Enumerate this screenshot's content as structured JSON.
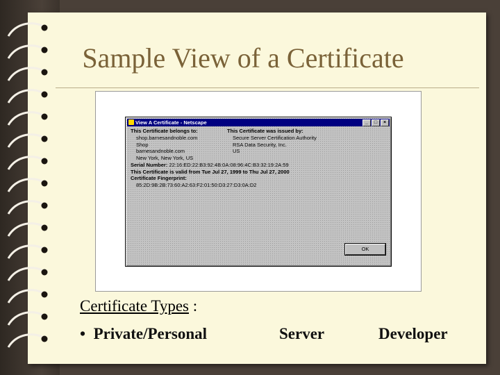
{
  "slide": {
    "title": "Sample View of a Certificate",
    "types_label": "Certificate Types",
    "types_suffix": " :",
    "bullet": "•",
    "items": [
      "Private/Personal",
      "Server",
      "Developer"
    ]
  },
  "window": {
    "title": "View A Certificate - Netscape",
    "belongs_heading": "This Certificate belongs to:",
    "belongs_lines": [
      "shop.barnesandnoble.com",
      "Shop",
      "barnesandnoble.com",
      "New York, New York, US"
    ],
    "issued_heading": "This Certificate was issued by:",
    "issued_lines": [
      "Secure Server Certification Authority",
      "RSA Data Security, Inc.",
      "US"
    ],
    "serial_label": "Serial Number:",
    "serial_value": "22:16:ED:22:B3:92:4B:0A:08:96:4C:B3:32:19:2A:59",
    "validity": "This Certificate is valid from Tue Jul 27, 1999 to Thu Jul 27, 2000",
    "fingerprint_label": "Certificate Fingerprint:",
    "fingerprint_value": "85:2D:9B:2B:73:60:A2:63:F2:01:50:D3:27:D3:0A:D2",
    "ok_label": "OK",
    "ctrl_minimize": "_",
    "ctrl_maximize": "□",
    "ctrl_close": "×"
  },
  "colors": {
    "page": "#fbf8dc",
    "title": "#7a6238",
    "titlebar": "#000080",
    "window": "#c3c3c3"
  },
  "icons": [
    "ring-binder-icon",
    "netscape-window-icon"
  ]
}
